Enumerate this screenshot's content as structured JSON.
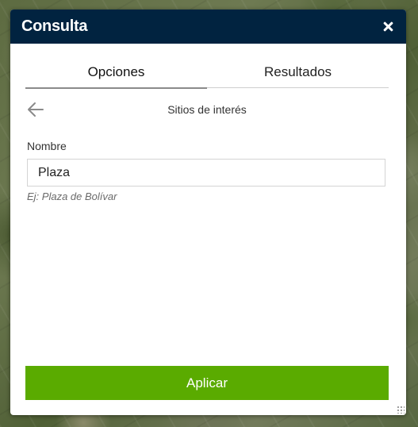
{
  "window": {
    "title": "Consulta",
    "close_icon": "close-icon"
  },
  "tabs": [
    {
      "label": "Opciones",
      "active": true
    },
    {
      "label": "Resultados",
      "active": false
    }
  ],
  "nav": {
    "back_icon": "arrow-left-icon",
    "section_title": "Sitios de interés"
  },
  "form": {
    "field_label": "Nombre",
    "field_value": "Plaza",
    "hint": "Ej: Plaza de Bolívar"
  },
  "actions": {
    "apply_label": "Aplicar"
  },
  "colors": {
    "titlebar": "#012340",
    "apply_button": "#5aab00"
  }
}
